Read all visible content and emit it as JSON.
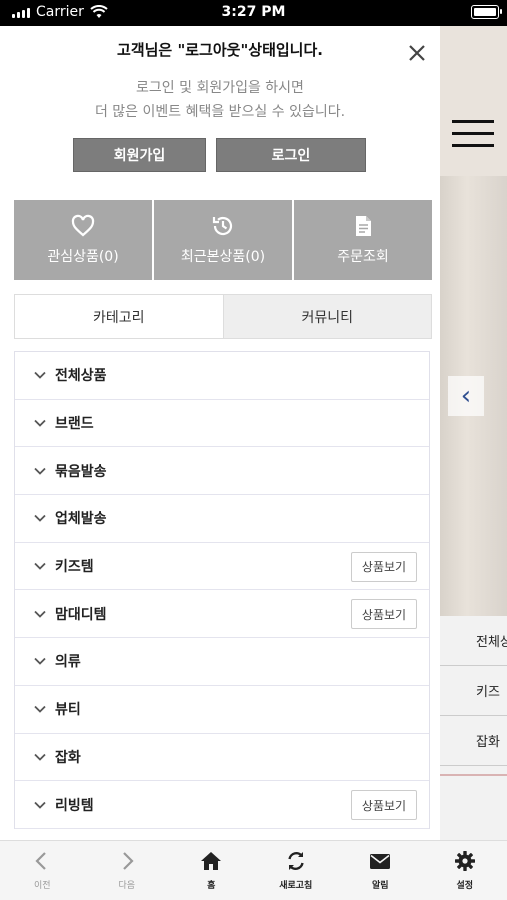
{
  "status_bar": {
    "carrier": "Carrier",
    "time": "3:27 PM"
  },
  "drawer": {
    "title": "고객님은 \"로그아웃\"상태입니다.",
    "desc_line1": "로그인 및 회원가입을 하시면",
    "desc_line2": "더 많은 이벤트 혜택을 받으실 수 있습니다.",
    "signup_label": "회원가입",
    "login_label": "로그인",
    "quick_links": [
      {
        "label": "관심상품(0)",
        "icon": "heart-icon"
      },
      {
        "label": "최근본상품(0)",
        "icon": "history-icon"
      },
      {
        "label": "주문조회",
        "icon": "document-icon"
      }
    ],
    "tabs": [
      {
        "label": "카테고리"
      },
      {
        "label": "커뮤니티"
      }
    ],
    "view_label": "상품보기",
    "categories": [
      {
        "label": "전체상품"
      },
      {
        "label": "브랜드"
      },
      {
        "label": "묶음발송"
      },
      {
        "label": "업체발송"
      },
      {
        "label": "키즈템"
      },
      {
        "label": "맘대디템"
      },
      {
        "label": "의류"
      },
      {
        "label": "뷰티"
      },
      {
        "label": "잡화"
      },
      {
        "label": "리빙템"
      }
    ]
  },
  "background_page": {
    "list_items": [
      "전체상",
      "키즈",
      "잡화"
    ]
  },
  "bottom_nav": {
    "items": [
      {
        "label": "이전",
        "icon": "chevron-left-icon"
      },
      {
        "label": "다음",
        "icon": "chevron-right-icon"
      },
      {
        "label": "홈",
        "icon": "home-icon"
      },
      {
        "label": "새로고침",
        "icon": "refresh-icon"
      },
      {
        "label": "알림",
        "icon": "mail-icon"
      },
      {
        "label": "설정",
        "icon": "gear-icon"
      }
    ]
  },
  "colors": {
    "button_gray": "#7d7d7d",
    "quick_gray": "#a8a8a8",
    "accent_blue": "#2f4f8f"
  }
}
